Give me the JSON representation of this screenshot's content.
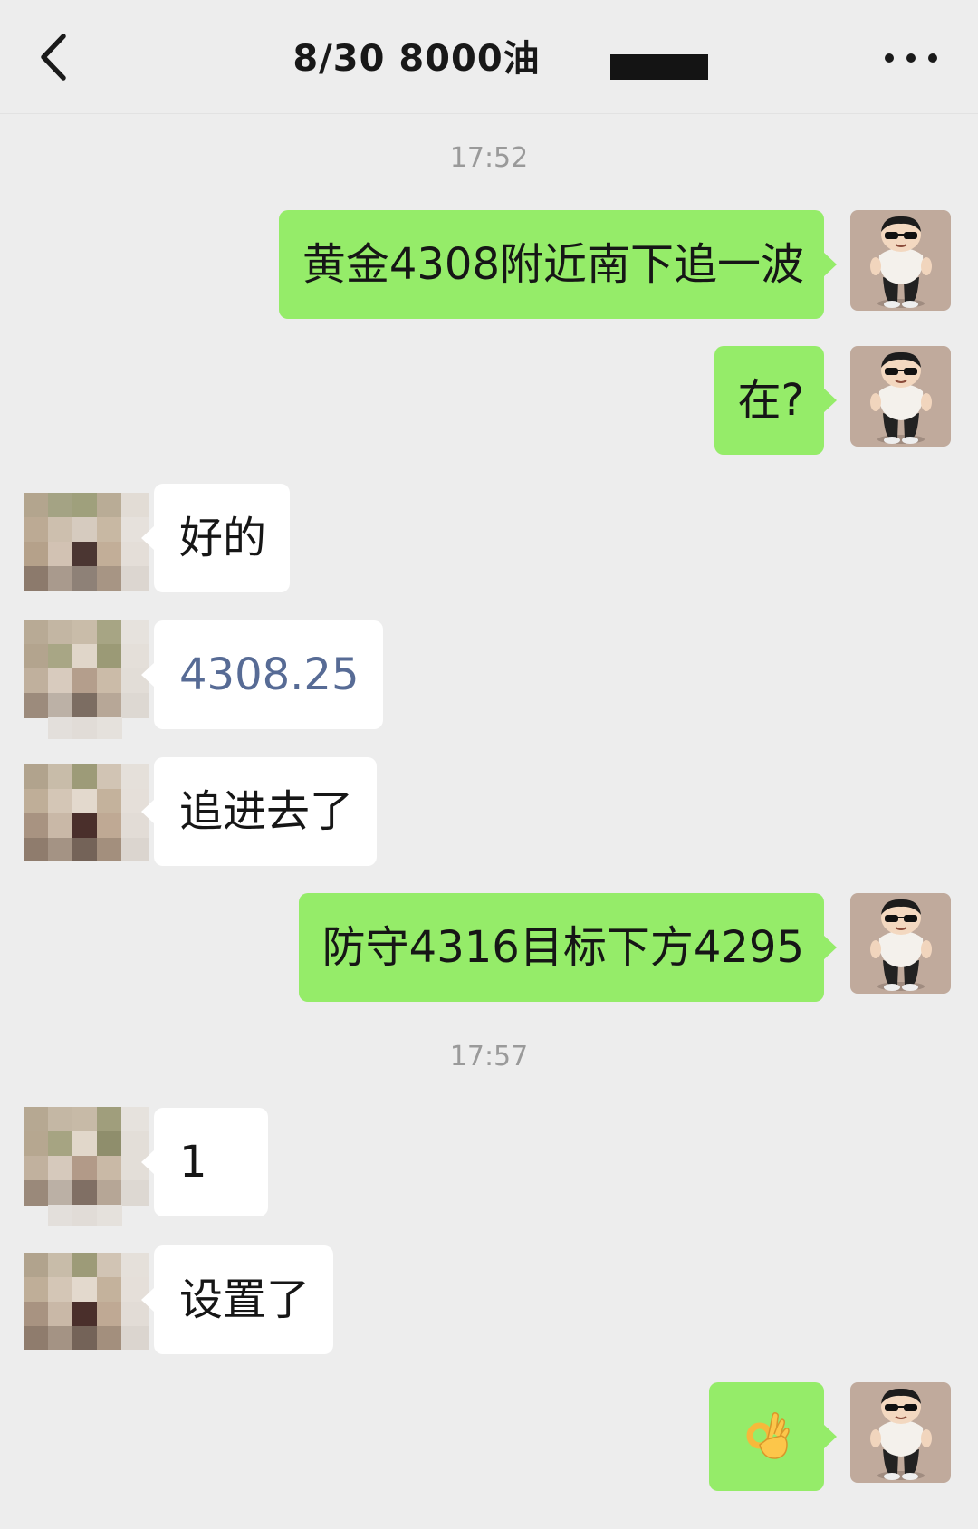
{
  "header": {
    "title": "8/30  8000油"
  },
  "timestamps": [
    "17:52",
    "17:57"
  ],
  "messages": [
    {
      "side": "right",
      "text": "黄金4308附近南下追一波"
    },
    {
      "side": "right",
      "text": "在?"
    },
    {
      "side": "left",
      "text": "好的"
    },
    {
      "side": "left",
      "text": "4308.25"
    },
    {
      "side": "left",
      "text": "追进去了"
    },
    {
      "side": "right",
      "text": "防守4316目标下方4295"
    },
    {
      "side": "left",
      "text": "1"
    },
    {
      "side": "left",
      "text": "设置了"
    },
    {
      "side": "right",
      "emoji": "ok-hand"
    }
  ],
  "colors": {
    "background": "#ededed",
    "sent_bubble": "#95ec69",
    "received_bubble": "#ffffff",
    "link": "#576b95",
    "timestamp": "#9a9a9a"
  },
  "icons": {
    "back": "chevron-left-icon",
    "more": "ellipsis-icon",
    "emoji": "ok-hand-emoji"
  }
}
